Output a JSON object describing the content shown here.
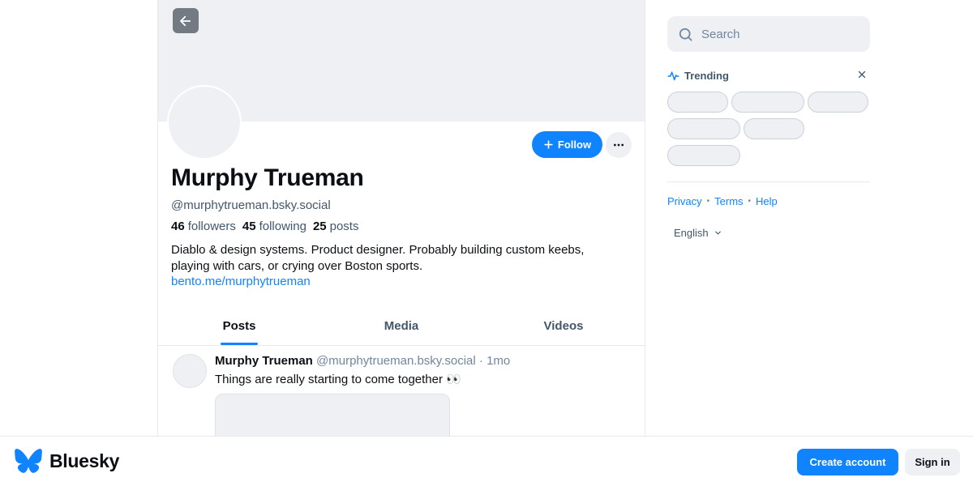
{
  "profile": {
    "display_name": "Murphy Trueman",
    "handle": "@murphytrueman.bsky.social",
    "followers_count": "46",
    "followers_label": "followers",
    "following_count": "45",
    "following_label": "following",
    "posts_count": "25",
    "posts_label": "posts",
    "bio": "Diablo & design systems. Product designer. Probably building custom keebs, playing with cars, or crying over Boston sports.",
    "link": "bento.me/murphytrueman",
    "follow_label": "Follow"
  },
  "tabs": [
    {
      "label": "Posts",
      "active": true
    },
    {
      "label": "Media",
      "active": false
    },
    {
      "label": "Videos",
      "active": false
    }
  ],
  "post": {
    "author": "Murphy Trueman",
    "handle": "@murphytrueman.bsky.social",
    "separator": "·",
    "time": "1mo",
    "text": "Things are really starting to come together 👀"
  },
  "sidebar": {
    "search_placeholder": "Search",
    "trending_title": "Trending",
    "footer_links": [
      "Privacy",
      "Terms",
      "Help"
    ],
    "language": "English"
  },
  "bottom_bar": {
    "brand": "Bluesky",
    "create_account_label": "Create account",
    "sign_in_label": "Sign in"
  },
  "colors": {
    "accent": "#1083fe",
    "muted_text": "#42576c",
    "placeholder_bg": "#eef0f3"
  }
}
